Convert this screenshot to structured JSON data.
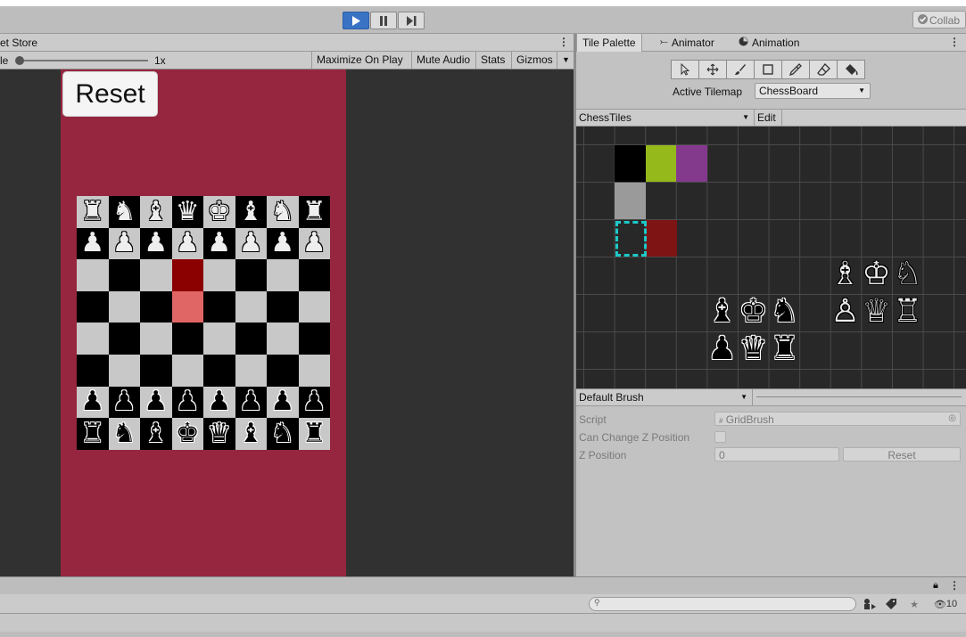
{
  "toolbar": {
    "collab_label": "Collab"
  },
  "game": {
    "tab_label": "et Store",
    "scale_label": "le",
    "scale_value": "1x",
    "maximize_label": "Maximize On Play",
    "mute_label": "Mute Audio",
    "stats_label": "Stats",
    "gizmos_label": "Gizmos",
    "reset_label": "Reset",
    "board_rows": [
      [
        "♜",
        "♞",
        "♝",
        "♛",
        "♚",
        "♝",
        "♞",
        "♜"
      ],
      [
        "♟",
        "♟",
        "♟",
        "♟",
        "♟",
        "♟",
        "♟",
        "♟"
      ],
      [
        "",
        "",
        "",
        "",
        "",
        "",
        "",
        ""
      ],
      [
        "",
        "",
        "",
        "",
        "",
        "",
        "",
        ""
      ],
      [
        "",
        "",
        "",
        "",
        "",
        "",
        "",
        ""
      ],
      [
        "",
        "",
        "",
        "",
        "",
        "",
        "",
        ""
      ],
      [
        "♟",
        "♟",
        "♟",
        "♟",
        "♟",
        "♟",
        "♟",
        "♟"
      ],
      [
        "♜",
        "♞",
        "♝",
        "♚",
        "♛",
        "♝",
        "♞",
        "♜"
      ]
    ],
    "highlight_colors": {
      "selected": "#8b0000",
      "target": "#e06666"
    }
  },
  "palette": {
    "tabs": [
      {
        "label": "Tile Palette",
        "icon": ""
      },
      {
        "label": "Animator",
        "icon": "animator-icon"
      },
      {
        "label": "Animation",
        "icon": "animation-icon"
      }
    ],
    "active_tilemap_label": "Active Tilemap",
    "active_tilemap_value": "ChessBoard",
    "tiles_dropdown": "ChessTiles",
    "edit_label": "Edit",
    "tile_colors": [
      "#000000",
      "#95b81b",
      "#833a8c",
      "#9a9a9a",
      "#7e1414"
    ],
    "white_top": [
      "♗",
      "♔",
      "♘"
    ],
    "white_bottom": [
      "♙",
      "♕",
      "♖"
    ],
    "black_top": [
      "♝",
      "♚",
      "♞"
    ],
    "black_bottom": [
      "♟",
      "♛",
      "♜"
    ]
  },
  "brush": {
    "dropdown_value": "Default Brush",
    "script_label": "Script",
    "script_value": "GridBrush",
    "change_z_label": "Can Change Z Position",
    "z_label": "Z Position",
    "z_value": "0",
    "reset_label": "Reset"
  },
  "bottom": {
    "hidden_count": "10"
  }
}
